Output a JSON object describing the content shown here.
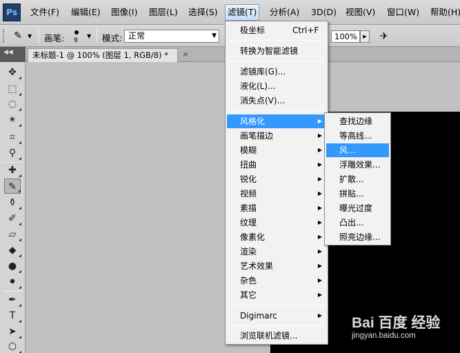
{
  "app": {
    "logo": "Ps"
  },
  "menubar": {
    "items": [
      "文件(F)",
      "编辑(E)",
      "图像(I)",
      "图层(L)",
      "选择(S)",
      "滤镜(T)",
      "分析(A)",
      "3D(D)",
      "视图(V)",
      "窗口(W)",
      "帮助(H)"
    ],
    "active": "滤镜(T)"
  },
  "options_bar": {
    "brush_label": "画笔:",
    "brush_size": "9",
    "mode_label": "模式:",
    "mode_value": "正常",
    "zoom_value": "100%"
  },
  "document": {
    "tab_title": "未标题-1 @ 100% (图层 1, RGB/8) *",
    "close": "×"
  },
  "filter_menu": {
    "items": [
      {
        "label": "极坐标",
        "shortcut": "Ctrl+F"
      },
      {
        "label": "转换为智能滤镜"
      },
      {
        "label": "滤镜库(G)..."
      },
      {
        "label": "液化(L)..."
      },
      {
        "label": "消失点(V)..."
      },
      {
        "label": "风格化",
        "submenu": true,
        "highlighted": true
      },
      {
        "label": "画笔描边",
        "submenu": true
      },
      {
        "label": "模糊",
        "submenu": true
      },
      {
        "label": "扭曲",
        "submenu": true
      },
      {
        "label": "锐化",
        "submenu": true
      },
      {
        "label": "视频",
        "submenu": true
      },
      {
        "label": "素描",
        "submenu": true
      },
      {
        "label": "纹理",
        "submenu": true
      },
      {
        "label": "像素化",
        "submenu": true
      },
      {
        "label": "渲染",
        "submenu": true
      },
      {
        "label": "艺术效果",
        "submenu": true
      },
      {
        "label": "杂色",
        "submenu": true
      },
      {
        "label": "其它",
        "submenu": true
      },
      {
        "label": "Digimarc",
        "submenu": true
      },
      {
        "label": "浏览联机滤镜..."
      }
    ]
  },
  "stylize_submenu": {
    "items": [
      "查找边缘",
      "等高线...",
      "风...",
      "浮雕效果...",
      "扩散...",
      "拼贴...",
      "曝光过度",
      "凸出...",
      "照亮边缘..."
    ],
    "highlighted": "风..."
  },
  "watermark": {
    "logo": "Bai 百度 经验",
    "url": "jingyan.baidu.com"
  },
  "colors": {
    "highlight": "#3399ff",
    "canvas": "#000000",
    "workspace": "#c0c0c0"
  }
}
